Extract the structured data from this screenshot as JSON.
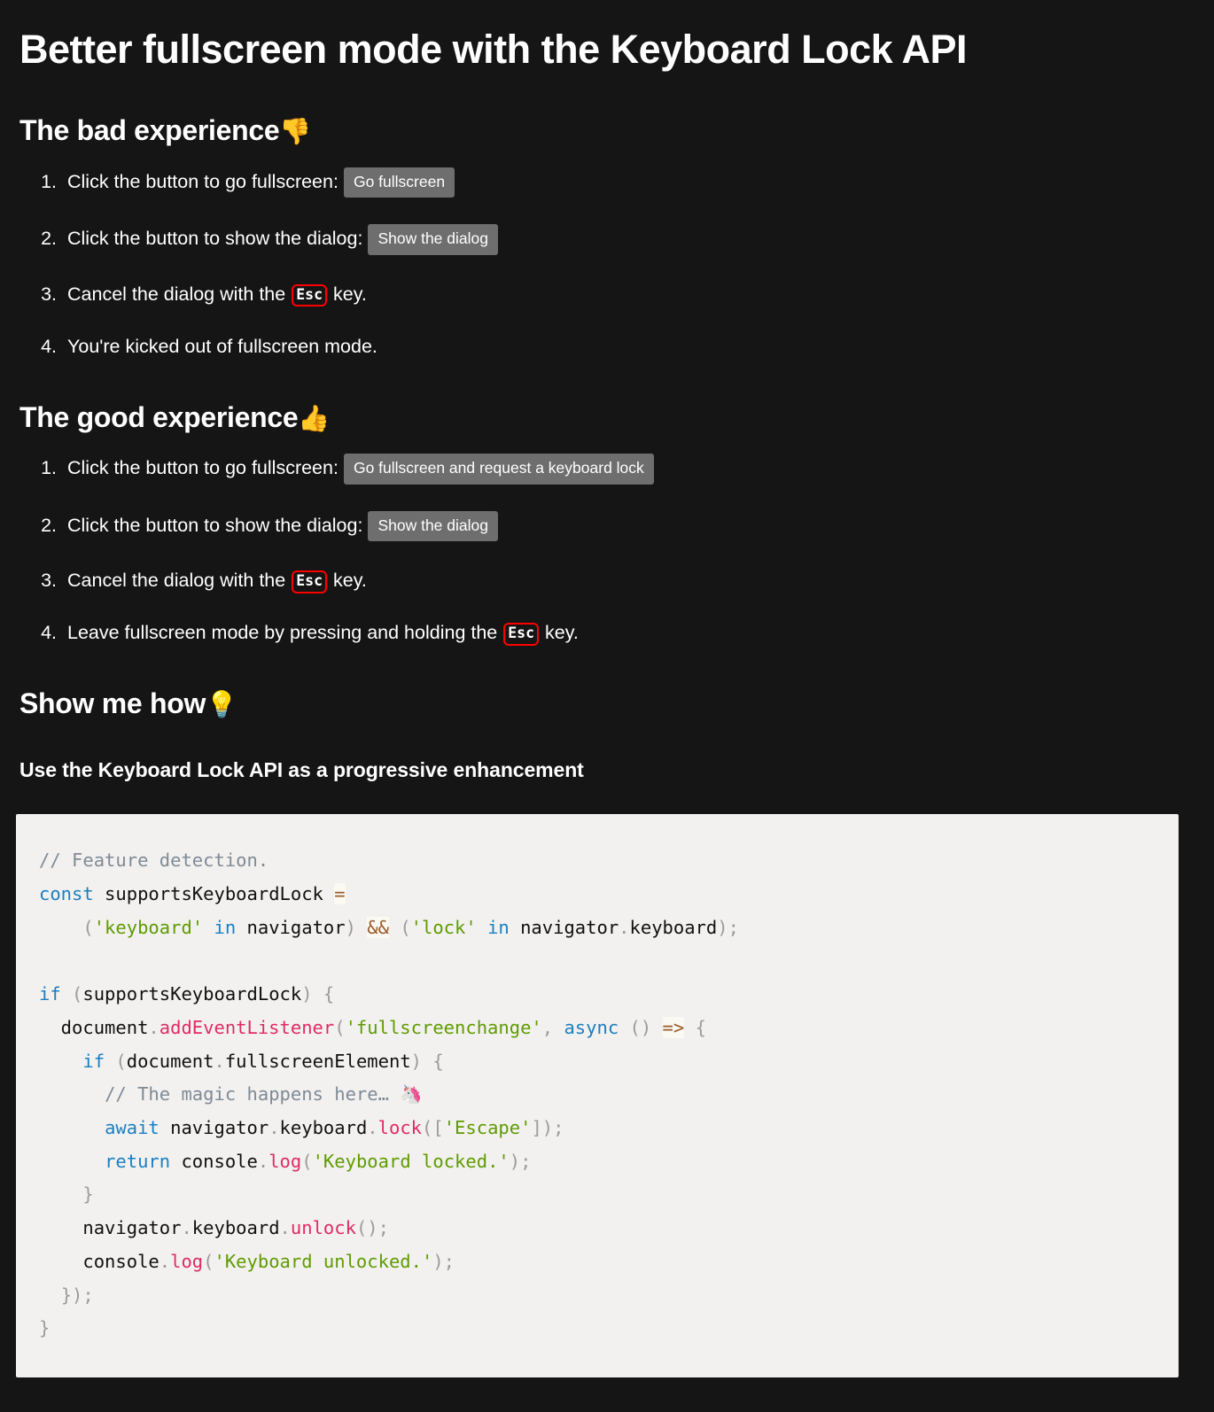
{
  "page": {
    "title": "Better fullscreen mode with the Keyboard Lock API",
    "background_color": "#151515",
    "text_color": "#ffffff"
  },
  "sections": {
    "bad": {
      "heading": "The bad experience",
      "heading_emoji": "👎",
      "steps": [
        {
          "prefix": "Click the button to go fullscreen:",
          "button": "Go fullscreen",
          "suffix": ""
        },
        {
          "prefix": "Click the button to show the dialog:",
          "button": "Show the dialog",
          "suffix": ""
        },
        {
          "prefix": "Cancel the dialog with the",
          "kbd": "Esc",
          "suffix": "key."
        },
        {
          "prefix": "You're kicked out of fullscreen mode.",
          "suffix": ""
        }
      ]
    },
    "good": {
      "heading": "The good experience",
      "heading_emoji": "👍",
      "steps": [
        {
          "prefix": "Click the button to go fullscreen:",
          "button": "Go fullscreen and request a keyboard lock",
          "suffix": ""
        },
        {
          "prefix": "Click the button to show the dialog:",
          "button": "Show the dialog",
          "suffix": ""
        },
        {
          "prefix": "Cancel the dialog with the",
          "kbd": "Esc",
          "suffix": "key."
        },
        {
          "prefix": "Leave fullscreen mode by pressing and holding the",
          "kbd": "Esc",
          "suffix": "key."
        }
      ]
    },
    "how": {
      "heading": "Show me how",
      "heading_emoji": "💡",
      "subheading": "Use the Keyboard Lock API as a progressive enhancement"
    }
  },
  "code": {
    "language": "javascript",
    "background_color": "#f2f1ef",
    "colors": {
      "comment": "#7f8a96",
      "keyword": "#1a7fc1",
      "string": "#5f9b00",
      "function": "#e02a68",
      "operator": "#9a5a28",
      "punctuation": "#9b9b9b",
      "plain": "#101010"
    },
    "plain_text": "// Feature detection.\nconst supportsKeyboardLock =\n    ('keyboard' in navigator) && ('lock' in navigator.keyboard);\n\nif (supportsKeyboardLock) {\n  document.addEventListener('fullscreenchange', async () => {\n    if (document.fullscreenElement) {\n      // The magic happens here… 🦄\n      await navigator.keyboard.lock(['Escape']);\n      return console.log('Keyboard locked.');\n    }\n    navigator.keyboard.unlock();\n    console.log('Keyboard unlocked.');\n  });\n}",
    "lines": [
      [
        {
          "t": "// Feature detection.",
          "c": "comment"
        }
      ],
      [
        {
          "t": "const",
          "c": "keyword"
        },
        {
          "t": " supportsKeyboardLock ",
          "c": "plain"
        },
        {
          "t": "=",
          "c": "op"
        }
      ],
      [
        {
          "t": "    ",
          "c": "plain"
        },
        {
          "t": "(",
          "c": "punct"
        },
        {
          "t": "'keyboard'",
          "c": "string"
        },
        {
          "t": " ",
          "c": "plain"
        },
        {
          "t": "in",
          "c": "keyword"
        },
        {
          "t": " navigator",
          "c": "plain"
        },
        {
          "t": ")",
          "c": "punct"
        },
        {
          "t": " ",
          "c": "plain"
        },
        {
          "t": "&&",
          "c": "op"
        },
        {
          "t": " ",
          "c": "plain"
        },
        {
          "t": "(",
          "c": "punct"
        },
        {
          "t": "'lock'",
          "c": "string"
        },
        {
          "t": " ",
          "c": "plain"
        },
        {
          "t": "in",
          "c": "keyword"
        },
        {
          "t": " navigator",
          "c": "plain"
        },
        {
          "t": ".",
          "c": "punct"
        },
        {
          "t": "keyboard",
          "c": "plain"
        },
        {
          "t": ");",
          "c": "punct"
        }
      ],
      [],
      [
        {
          "t": "if",
          "c": "keyword"
        },
        {
          "t": " ",
          "c": "plain"
        },
        {
          "t": "(",
          "c": "punct"
        },
        {
          "t": "supportsKeyboardLock",
          "c": "plain"
        },
        {
          "t": ")",
          "c": "punct"
        },
        {
          "t": " ",
          "c": "plain"
        },
        {
          "t": "{",
          "c": "punct"
        }
      ],
      [
        {
          "t": "  document",
          "c": "plain"
        },
        {
          "t": ".",
          "c": "punct"
        },
        {
          "t": "addEventListener",
          "c": "func"
        },
        {
          "t": "(",
          "c": "punct"
        },
        {
          "t": "'fullscreenchange'",
          "c": "string"
        },
        {
          "t": ", ",
          "c": "punct"
        },
        {
          "t": "async",
          "c": "keyword"
        },
        {
          "t": " ",
          "c": "plain"
        },
        {
          "t": "()",
          "c": "punct"
        },
        {
          "t": " ",
          "c": "plain"
        },
        {
          "t": "=>",
          "c": "op"
        },
        {
          "t": " ",
          "c": "plain"
        },
        {
          "t": "{",
          "c": "punct"
        }
      ],
      [
        {
          "t": "    ",
          "c": "plain"
        },
        {
          "t": "if",
          "c": "keyword"
        },
        {
          "t": " ",
          "c": "plain"
        },
        {
          "t": "(",
          "c": "punct"
        },
        {
          "t": "document",
          "c": "plain"
        },
        {
          "t": ".",
          "c": "punct"
        },
        {
          "t": "fullscreenElement",
          "c": "plain"
        },
        {
          "t": ")",
          "c": "punct"
        },
        {
          "t": " ",
          "c": "plain"
        },
        {
          "t": "{",
          "c": "punct"
        }
      ],
      [
        {
          "t": "      ",
          "c": "plain"
        },
        {
          "t": "// The magic happens here… 🦄",
          "c": "comment"
        }
      ],
      [
        {
          "t": "      ",
          "c": "plain"
        },
        {
          "t": "await",
          "c": "keyword"
        },
        {
          "t": " navigator",
          "c": "plain"
        },
        {
          "t": ".",
          "c": "punct"
        },
        {
          "t": "keyboard",
          "c": "plain"
        },
        {
          "t": ".",
          "c": "punct"
        },
        {
          "t": "lock",
          "c": "func"
        },
        {
          "t": "([",
          "c": "punct"
        },
        {
          "t": "'Escape'",
          "c": "string"
        },
        {
          "t": "]);",
          "c": "punct"
        }
      ],
      [
        {
          "t": "      ",
          "c": "plain"
        },
        {
          "t": "return",
          "c": "keyword"
        },
        {
          "t": " console",
          "c": "plain"
        },
        {
          "t": ".",
          "c": "punct"
        },
        {
          "t": "log",
          "c": "func"
        },
        {
          "t": "(",
          "c": "punct"
        },
        {
          "t": "'Keyboard locked.'",
          "c": "string"
        },
        {
          "t": ");",
          "c": "punct"
        }
      ],
      [
        {
          "t": "    ",
          "c": "plain"
        },
        {
          "t": "}",
          "c": "punct"
        }
      ],
      [
        {
          "t": "    navigator",
          "c": "plain"
        },
        {
          "t": ".",
          "c": "punct"
        },
        {
          "t": "keyboard",
          "c": "plain"
        },
        {
          "t": ".",
          "c": "punct"
        },
        {
          "t": "unlock",
          "c": "func"
        },
        {
          "t": "();",
          "c": "punct"
        }
      ],
      [
        {
          "t": "    console",
          "c": "plain"
        },
        {
          "t": ".",
          "c": "punct"
        },
        {
          "t": "log",
          "c": "func"
        },
        {
          "t": "(",
          "c": "punct"
        },
        {
          "t": "'Keyboard unlocked.'",
          "c": "string"
        },
        {
          "t": ");",
          "c": "punct"
        }
      ],
      [
        {
          "t": "  ",
          "c": "plain"
        },
        {
          "t": "});",
          "c": "punct"
        }
      ],
      [
        {
          "t": "}",
          "c": "punct"
        }
      ]
    ]
  }
}
